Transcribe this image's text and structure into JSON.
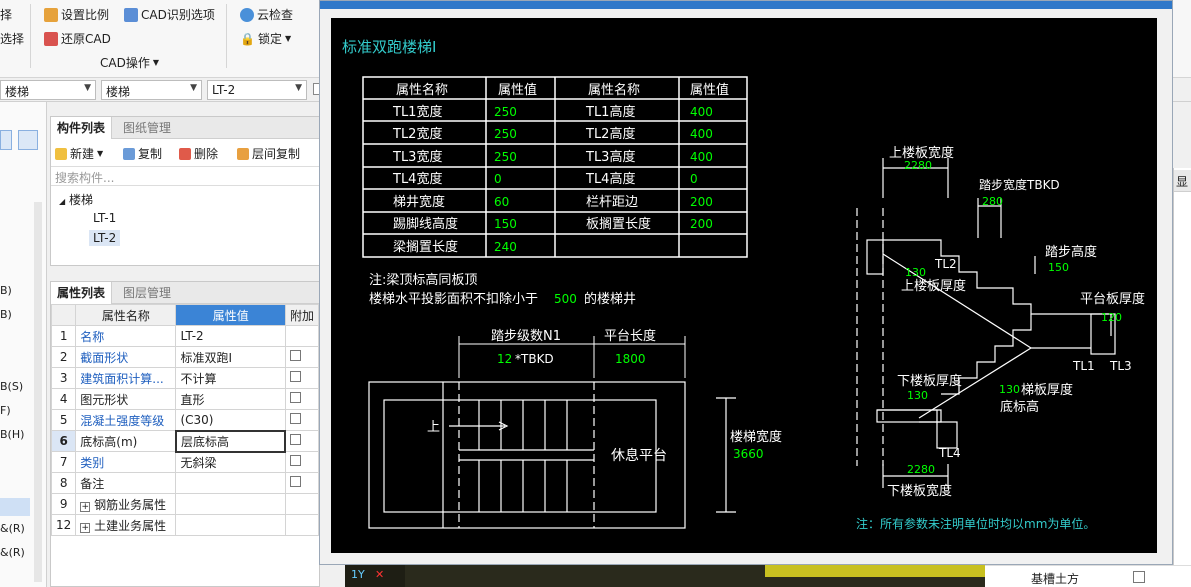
{
  "ribbon": {
    "left_items": [
      "择",
      "选择"
    ],
    "set_scale": "设置比例",
    "cad_options": "CAD识别选项",
    "restore_cad": "还原CAD",
    "cad_ops_group": "CAD操作",
    "cloud_check": "云检查",
    "lock": "锁定"
  },
  "selectors": {
    "first": "楼梯",
    "second": "楼梯",
    "third": "LT-2"
  },
  "left_strip": [
    "B)",
    "B)",
    "B(S)",
    "F)",
    "B(H)",
    "&(R)",
    "&(R)"
  ],
  "component_panel": {
    "tab_active": "构件列表",
    "tab_inactive": "图纸管理",
    "new": "新建",
    "copy": "复制",
    "delete": "删除",
    "floor_copy": "层间复制",
    "search_placeholder": "搜索构件...",
    "tree_root": "楼梯",
    "items": [
      "LT-1",
      "LT-2"
    ]
  },
  "property_panel": {
    "tab_active": "属性列表",
    "tab_inactive": "图层管理",
    "headers": [
      "属性名称",
      "属性值",
      "附加"
    ],
    "rows": [
      {
        "num": "1",
        "name": "名称",
        "value": "LT-2"
      },
      {
        "num": "2",
        "name": "截面形状",
        "value": "标准双跑I"
      },
      {
        "num": "3",
        "name": "建筑面积计算...",
        "value": "不计算"
      },
      {
        "num": "4",
        "name": "图元形状",
        "value": "直形"
      },
      {
        "num": "5",
        "name": "混凝土强度等级",
        "value": "(C30)"
      },
      {
        "num": "6",
        "name": "底标高(m)",
        "value": "层底标高"
      },
      {
        "num": "7",
        "name": "类别",
        "value": "无斜梁"
      },
      {
        "num": "8",
        "name": "备注",
        "value": ""
      },
      {
        "num": "9",
        "name": "钢筋业务属性",
        "value": ""
      },
      {
        "num": "12",
        "name": "土建业务属性",
        "value": ""
      }
    ]
  },
  "cad": {
    "title": "标准双跑楼梯Ⅰ",
    "table_headers": [
      "属性名称",
      "属性值",
      "属性名称",
      "属性值"
    ],
    "table_rows": [
      [
        "TL1宽度",
        "250",
        "TL1高度",
        "400"
      ],
      [
        "TL2宽度",
        "250",
        "TL2高度",
        "400"
      ],
      [
        "TL3宽度",
        "250",
        "TL3高度",
        "400"
      ],
      [
        "TL4宽度",
        "0",
        "TL4高度",
        "0"
      ],
      [
        "梯井宽度",
        "60",
        "栏杆距边",
        "200"
      ],
      [
        "踢脚线高度",
        "150",
        "板搁置长度",
        "200"
      ],
      [
        "梁搁置长度",
        "240",
        "",
        ""
      ]
    ],
    "note1": "注:梁顶标高同板顶",
    "note2_a": "楼梯水平投影面积不扣除小于",
    "note2_val": "500",
    "note2_b": "的楼梯井",
    "step_count_label": "踏步级数N1",
    "step_count_val": "12",
    "step_count_suffix": "*TBKD",
    "platform_len_label": "平台长度",
    "platform_len_val": "1800",
    "up_label": "上",
    "rest_platform": "休息平台",
    "stair_width_label": "楼梯宽度",
    "stair_width_val": "3660",
    "top_slab_width": "上楼板宽度",
    "top_slab_width_val": "2280",
    "tread_width": "踏步宽度TBKD",
    "tread_width_val": "280",
    "step_height": "踏步高度",
    "step_height_val": "150",
    "tl2": "TL2",
    "top_slab_thk_val": "130",
    "top_slab_thk": "上楼板厚度",
    "platform_thk": "平台板厚度",
    "platform_thk_val": "120",
    "tl1": "TL1",
    "tl3": "TL3",
    "bottom_slab_thk": "下楼板厚度",
    "bottom_slab_thk_val": "130",
    "stair_thk_val": "130",
    "stair_thk": "梯板厚度",
    "bottom_elev": "底标高",
    "tl4": "TL4",
    "bottom_slab_width_val": "2280",
    "bottom_slab_width": "下楼板宽度",
    "unit_note": "注：所有参数未注明单位时均以mm为单位。"
  },
  "right_panel": {
    "header_char": "显",
    "bottom_label": "基槽土方"
  },
  "colors": {
    "cad_bg": "#000000",
    "cad_white": "#ffffff",
    "cad_green": "#00ff00",
    "cad_cyan": "#33cccc",
    "link_blue": "#1f5fbf",
    "title_bar": "#2f78c9"
  }
}
